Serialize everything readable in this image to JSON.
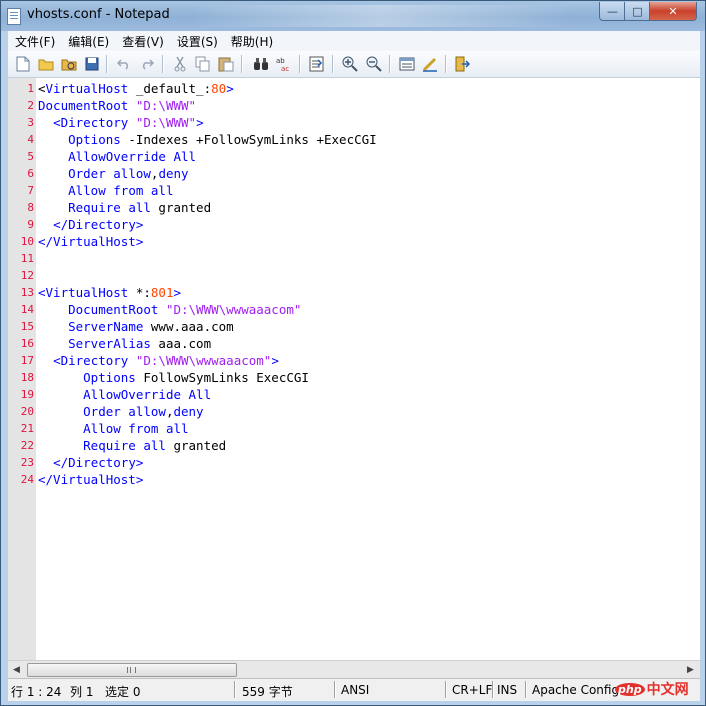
{
  "window": {
    "title": "vhosts.conf - Notepad"
  },
  "menu": {
    "items": [
      "文件(F)",
      "编辑(E)",
      "查看(V)",
      "设置(S)",
      "帮助(H)"
    ]
  },
  "toolbar": {
    "buttons": [
      "new-file-icon",
      "open-file-icon",
      "open-folder-icon",
      "save-icon",
      "undo-icon",
      "redo-icon",
      "cut-icon",
      "copy-icon",
      "paste-icon",
      "find-icon",
      "replace-icon",
      "goto-icon",
      "zoom-in-icon",
      "zoom-out-icon",
      "view-icon",
      "edit-icon",
      "exit-icon"
    ]
  },
  "editor": {
    "line_numbers": [
      "1",
      "2",
      "3",
      "4",
      "5",
      "6",
      "7",
      "8",
      "9",
      "10",
      "11",
      "12",
      "13",
      "14",
      "15",
      "16",
      "17",
      "18",
      "19",
      "20",
      "21",
      "22",
      "23",
      "24"
    ],
    "lines": [
      [
        [
          "t",
          "<"
        ],
        [
          "tag",
          "VirtualHost"
        ],
        [
          "t",
          " _default_:"
        ],
        [
          "num",
          "80"
        ],
        [
          "tag",
          ">"
        ]
      ],
      [
        [
          "tag",
          "DocumentRoot"
        ],
        [
          "t",
          " "
        ],
        [
          "str",
          "\"D:\\WWW\""
        ]
      ],
      [
        [
          "t",
          "  "
        ],
        [
          "tag",
          "<Directory"
        ],
        [
          "t",
          " "
        ],
        [
          "str",
          "\"D:\\WWW\""
        ],
        [
          "tag",
          ">"
        ]
      ],
      [
        [
          "t",
          "    "
        ],
        [
          "key",
          "Options"
        ],
        [
          "t",
          " -Indexes +FollowSymLinks +ExecCGI"
        ]
      ],
      [
        [
          "t",
          "    "
        ],
        [
          "key",
          "AllowOverride All"
        ]
      ],
      [
        [
          "t",
          "    "
        ],
        [
          "key",
          "Order allow"
        ],
        [
          "t",
          ","
        ],
        [
          "key",
          "deny"
        ]
      ],
      [
        [
          "t",
          "    "
        ],
        [
          "key",
          "Allow from all"
        ]
      ],
      [
        [
          "t",
          "    "
        ],
        [
          "key",
          "Require all"
        ],
        [
          "t",
          " granted"
        ]
      ],
      [
        [
          "t",
          "  "
        ],
        [
          "tag",
          "</Directory>"
        ]
      ],
      [
        [
          "tag",
          "</VirtualHost>"
        ]
      ],
      [],
      [],
      [
        [
          "tag",
          "<VirtualHost"
        ],
        [
          "t",
          " *:"
        ],
        [
          "num",
          "801"
        ],
        [
          "tag",
          ">"
        ]
      ],
      [
        [
          "t",
          "    "
        ],
        [
          "key",
          "DocumentRoot"
        ],
        [
          "t",
          " "
        ],
        [
          "str",
          "\"D:\\WWW\\wwwaaacom\""
        ]
      ],
      [
        [
          "t",
          "    "
        ],
        [
          "key",
          "ServerName"
        ],
        [
          "t",
          " www.aaa.com"
        ]
      ],
      [
        [
          "t",
          "    "
        ],
        [
          "key",
          "ServerAlias"
        ],
        [
          "t",
          " aaa.com"
        ]
      ],
      [
        [
          "t",
          "  "
        ],
        [
          "tag",
          "<Directory"
        ],
        [
          "t",
          " "
        ],
        [
          "str",
          "\"D:\\WWW\\wwwaaacom\""
        ],
        [
          "tag",
          ">"
        ]
      ],
      [
        [
          "t",
          "      "
        ],
        [
          "key",
          "Options"
        ],
        [
          "t",
          " FollowSymLinks ExecCGI"
        ]
      ],
      [
        [
          "t",
          "      "
        ],
        [
          "key",
          "AllowOverride All"
        ]
      ],
      [
        [
          "t",
          "      "
        ],
        [
          "key",
          "Order allow"
        ],
        [
          "t",
          ","
        ],
        [
          "key",
          "deny"
        ]
      ],
      [
        [
          "t",
          "      "
        ],
        [
          "key",
          "Allow from all"
        ]
      ],
      [
        [
          "t",
          "      "
        ],
        [
          "key",
          "Require all"
        ],
        [
          "t",
          " granted"
        ]
      ],
      [
        [
          "t",
          "  "
        ],
        [
          "tag",
          "</Directory>"
        ]
      ],
      [
        [
          "tag",
          "</VirtualHost>"
        ]
      ]
    ]
  },
  "scrollbar": {
    "thumb_grip": "III"
  },
  "status": {
    "line": "行 1 : 24",
    "col": "列 1",
    "selection": "选定 0",
    "bytes": "559 字节",
    "encoding": "ANSI",
    "eol": "CR+LF",
    "mode": "INS",
    "syntax": "Apache Config"
  },
  "watermark": {
    "badge": "php",
    "text": "中文网"
  }
}
